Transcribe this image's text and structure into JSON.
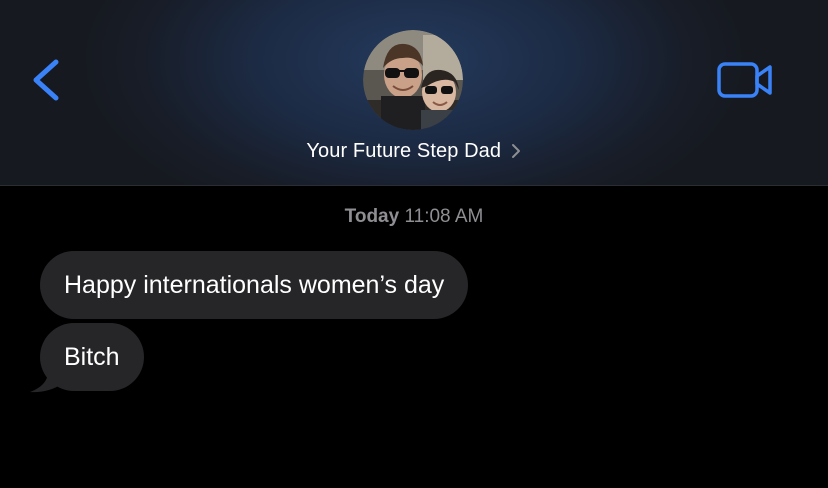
{
  "header": {
    "contact_name": "Your Future Step Dad",
    "icons": {
      "back": "chevron-left-icon",
      "video": "video-camera-icon",
      "name_chevron": "chevron-right-icon"
    },
    "accent_color": "#3a82f7"
  },
  "conversation": {
    "timestamp_day": "Today",
    "timestamp_time": "11:08 AM",
    "messages": [
      {
        "text": "Happy internationals women’s day",
        "direction": "incoming"
      },
      {
        "text": "Bitch",
        "direction": "incoming"
      }
    ]
  },
  "colors": {
    "incoming_bubble": "#262629",
    "background": "#000000",
    "timestamp": "#8e8e93"
  }
}
